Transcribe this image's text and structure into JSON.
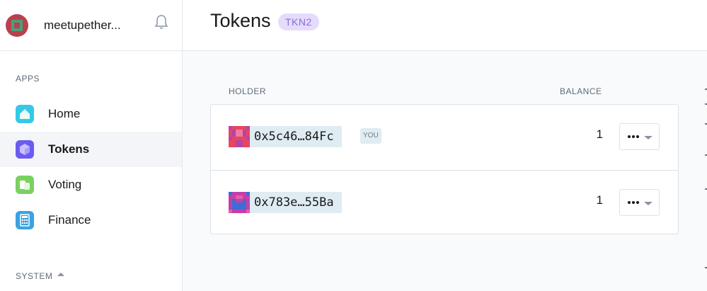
{
  "org": {
    "name": "meetupether...",
    "avatar_icon": "org-identicon",
    "notifications_icon": "bell-icon"
  },
  "sidebar": {
    "apps_label": "APPS",
    "system_label": "SYSTEM",
    "items": [
      {
        "label": "Home",
        "icon": "home-icon",
        "color": "#35c9e8",
        "active": false
      },
      {
        "label": "Tokens",
        "icon": "tokens-cube-icon",
        "color": "#6a5cf0",
        "active": true
      },
      {
        "label": "Voting",
        "icon": "voting-icon",
        "color": "#7bd160",
        "active": false
      },
      {
        "label": "Finance",
        "icon": "finance-calculator-icon",
        "color": "#3aa3e3",
        "active": false
      }
    ]
  },
  "header": {
    "title": "Tokens",
    "token_symbol": "TKN2"
  },
  "table": {
    "columns": {
      "holder": "HOLDER",
      "balance": "BALANCE"
    },
    "rows": [
      {
        "address": "0x5c46…84Fc",
        "you_badge": "YOU",
        "balance": "1",
        "identicon_colors": [
          "#e8455f",
          "#b146a8",
          "#f27aa0"
        ]
      },
      {
        "address": "0x783e…55Ba",
        "you_badge": "",
        "balance": "1",
        "identicon_colors": [
          "#c53ea8",
          "#3f6bd6",
          "#e85aa8"
        ]
      }
    ]
  },
  "colors": {
    "accent_badge_bg": "#e5dcfb",
    "accent_badge_text": "#8a6bd8",
    "address_chip_bg": "#dfecf2"
  }
}
